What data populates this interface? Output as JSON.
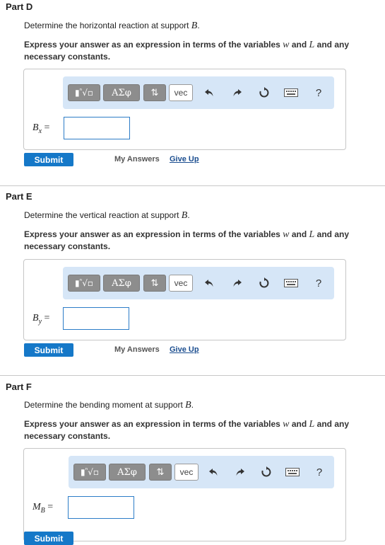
{
  "parts": [
    {
      "title": "Part D",
      "prompt_text": "Determine the horizontal reaction at support ",
      "prompt_var": "B",
      "prompt_end": ".",
      "instr_a": "Express your answer as an expression in terms of the variables ",
      "var_w": "w",
      "instr_and": " and ",
      "var_L": "L",
      "instr_b": " and any necessary constants.",
      "label_main": "B",
      "label_sub": "x",
      "label_eq": "=",
      "submit": "Submit",
      "my_answers": "My Answers",
      "give_up": "Give Up"
    },
    {
      "title": "Part E",
      "prompt_text": "Determine the vertical reaction at support ",
      "prompt_var": "B",
      "prompt_end": ".",
      "instr_a": "Express your answer as an expression in terms of the variables ",
      "var_w": "w",
      "instr_and": " and ",
      "var_L": "L",
      "instr_b": " and any necessary constants.",
      "label_main": "B",
      "label_sub": "y",
      "label_eq": "=",
      "submit": "Submit",
      "my_answers": "My Answers",
      "give_up": "Give Up"
    },
    {
      "title": "Part F",
      "prompt_text": "Determine the bending moment at support ",
      "prompt_var": "B",
      "prompt_end": ".",
      "instr_a": "Express your answer as an expression in terms of the variables ",
      "var_w": "w",
      "instr_and": " and ",
      "var_L": "L",
      "instr_b": " and any necessary constants.",
      "label_main": "M",
      "label_sub": "B",
      "label_eq": "=",
      "submit": "Submit"
    }
  ],
  "toolbar": {
    "templates_label": "ⁿ√▫",
    "symbols_label": "ΑΣφ",
    "arrows_label": "⇅",
    "vec_label": "vec",
    "help_label": "?"
  },
  "colors": {
    "toolbar_bg": "#d6e6f7",
    "submit_bg": "#1578c8",
    "input_border": "#2c7cc7",
    "give_up": "#1a4d8f"
  }
}
